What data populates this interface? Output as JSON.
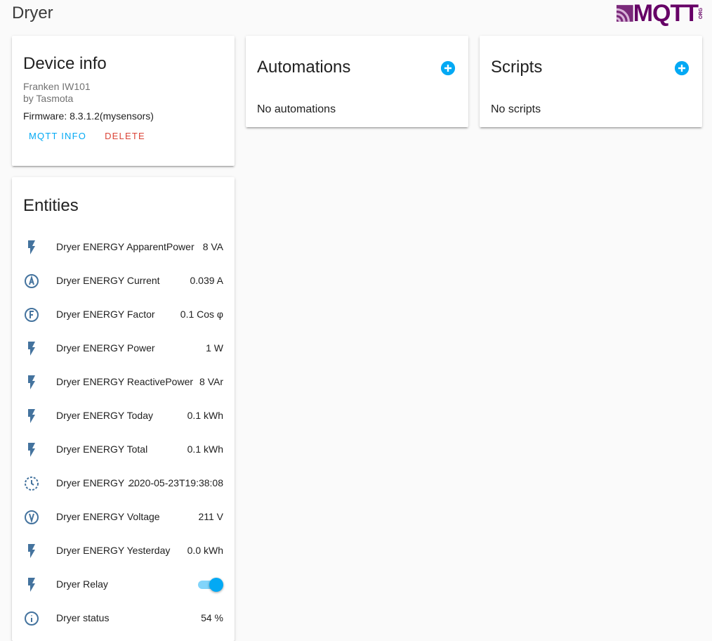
{
  "page": {
    "title": "Dryer"
  },
  "logo": {
    "text": "MQTT",
    "suffix": "ORG"
  },
  "colors": {
    "accent": "#03a9f4",
    "delete": "#db4437",
    "icon": "#44739e"
  },
  "device_info": {
    "title": "Device info",
    "model": "Franken IW101",
    "manufacturer": "by Tasmota",
    "firmware": "Firmware: 8.3.1.2(mysensors)",
    "mqtt_info_label": "MQTT INFO",
    "delete_label": "DELETE"
  },
  "automations": {
    "title": "Automations",
    "empty": "No automations"
  },
  "scripts": {
    "title": "Scripts",
    "empty": "No scripts"
  },
  "entities": {
    "title": "Entities",
    "items": [
      {
        "icon": "flash-icon",
        "name": "Dryer ENERGY ApparentPower",
        "state": "8 VA"
      },
      {
        "icon": "alpha-a-circle-icon",
        "name": "Dryer ENERGY Current",
        "state": "0.039 A"
      },
      {
        "icon": "alpha-f-circle-icon",
        "name": "Dryer ENERGY Factor",
        "state": "0.1 Cos φ"
      },
      {
        "icon": "flash-icon",
        "name": "Dryer ENERGY Power",
        "state": "1 W"
      },
      {
        "icon": "flash-icon",
        "name": "Dryer ENERGY ReactivePower",
        "state": "8 VAr"
      },
      {
        "icon": "flash-icon",
        "name": "Dryer ENERGY Today",
        "state": "0.1 kWh"
      },
      {
        "icon": "flash-icon",
        "name": "Dryer ENERGY Total",
        "state": "0.1 kWh"
      },
      {
        "icon": "clock-icon",
        "name": "Dryer ENERGY …",
        "state": "2020-05-23T19:38:08"
      },
      {
        "icon": "alpha-v-circle-icon",
        "name": "Dryer ENERGY Voltage",
        "state": "211 V"
      },
      {
        "icon": "flash-icon",
        "name": "Dryer ENERGY Yesterday",
        "state": "0.0 kWh"
      },
      {
        "icon": "flash-icon",
        "name": "Dryer Relay",
        "toggle": true
      },
      {
        "icon": "info-icon",
        "name": "Dryer status",
        "state": "54 %"
      }
    ]
  }
}
